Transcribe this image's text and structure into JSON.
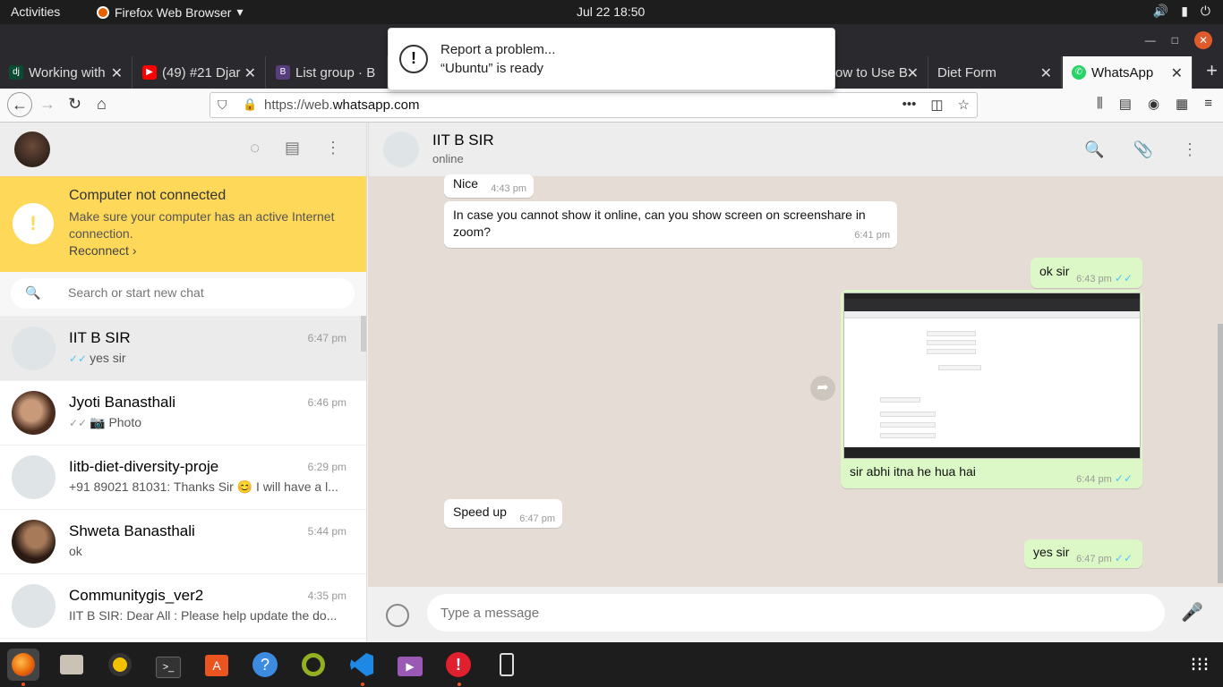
{
  "system": {
    "activities": "Activities",
    "app_name": "Firefox Web Browser",
    "clock": "Jul 22  18:50"
  },
  "notification": {
    "title": "Report a problem...",
    "body": "“Ubuntu” is ready"
  },
  "tabs": [
    {
      "label": "Working with"
    },
    {
      "label": "(49) #21 Djar"
    },
    {
      "label": "List group · B"
    },
    {
      "label": "ow to Use B"
    },
    {
      "label": "Diet Form"
    },
    {
      "label": "WhatsApp"
    }
  ],
  "navbar": {
    "url_prefix": "https://web.",
    "url_domain": "whatsapp.com"
  },
  "sidebar": {
    "banner_title": "Computer not connected",
    "banner_text": "Make sure your computer has an active Internet connection.",
    "banner_link": "Reconnect ›",
    "search_placeholder": "Search or start new chat",
    "chats": [
      {
        "name": "IIT B SIR",
        "time": "6:47 pm",
        "msg": "yes sir"
      },
      {
        "name": "Jyoti Banasthali",
        "time": "6:46 pm",
        "msg": "Photo"
      },
      {
        "name": "Iitb-diet-diversity-proje",
        "time": "6:29 pm",
        "msg": "+91 89021 81031: Thanks Sir 😊 I will have a l..."
      },
      {
        "name": "Shweta Banasthali",
        "time": "5:44 pm",
        "msg": "ok"
      },
      {
        "name": "Communitygis_ver2",
        "time": "4:35 pm",
        "msg": "IIT B SIR: Dear All : Please help update the do..."
      }
    ]
  },
  "conversation": {
    "contact": "IIT B SIR",
    "status": "online",
    "messages": [
      {
        "text": "Nice",
        "time": "4:43 pm"
      },
      {
        "text": "In case you cannot show it online, can you show screen on screenshare in zoom?",
        "time": "6:41 pm"
      },
      {
        "text": "ok sir",
        "time": "6:43 pm"
      },
      {
        "text": "sir abhi itna he hua hai",
        "time": "6:44 pm"
      },
      {
        "text": "Speed up",
        "time": "6:47 pm"
      },
      {
        "text": "yes sir",
        "time": "6:47 pm"
      }
    ],
    "composer_placeholder": "Type a message"
  },
  "icons": [
    "firefox-icon",
    "files-icon",
    "rhythmbox-icon",
    "terminal-icon",
    "software-icon",
    "help-icon",
    "qgis-icon",
    "vscode-icon",
    "video-icon",
    "error-icon",
    "usb-icon",
    "apps-grid-icon"
  ],
  "colors": {
    "banner": "#fed859",
    "outgoing": "#dcf8c6",
    "wallpaper": "#e5ddd5"
  }
}
